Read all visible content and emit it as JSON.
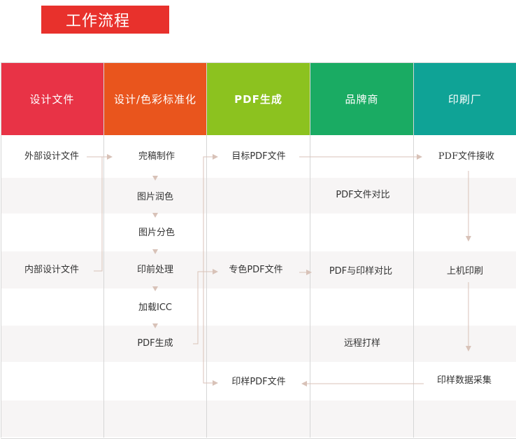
{
  "title": "工作流程",
  "colors": {
    "title_bg": "#e8312c",
    "col_design": "#e83346",
    "col_standard": "#e9551d",
    "col_pdf": "#8cc21f",
    "col_brand": "#1aab63",
    "col_print": "#0fa396",
    "connector": "#d8c2b8",
    "band": "#f7f5f5"
  },
  "columns": [
    {
      "id": "design",
      "label": "设计文件"
    },
    {
      "id": "standard",
      "label": "设计/色彩标准化"
    },
    {
      "id": "pdf",
      "label": "PDF生成"
    },
    {
      "id": "brand",
      "label": "品牌商"
    },
    {
      "id": "print",
      "label": "印刷厂"
    }
  ],
  "nodes": {
    "external_design": "外部设计文件",
    "internal_design": "内部设计文件",
    "draft": "完稿制作",
    "retouch": "图片润色",
    "separation": "图片分色",
    "prepress": "印前处理",
    "load_icc": "加载ICC",
    "pdf_gen": "PDF生成",
    "target_pdf": "目标PDF文件",
    "spot_pdf": "专色PDF文件",
    "proof_pdf": "印样PDF文件",
    "pdf_compare": "PDF文件对比",
    "pdf_proof_compare": "PDF与印样对比",
    "remote_proof": "远程打样",
    "pdf_receive": "PDF文件接收",
    "press": "上机印刷",
    "proof_data": "印样数据采集"
  }
}
